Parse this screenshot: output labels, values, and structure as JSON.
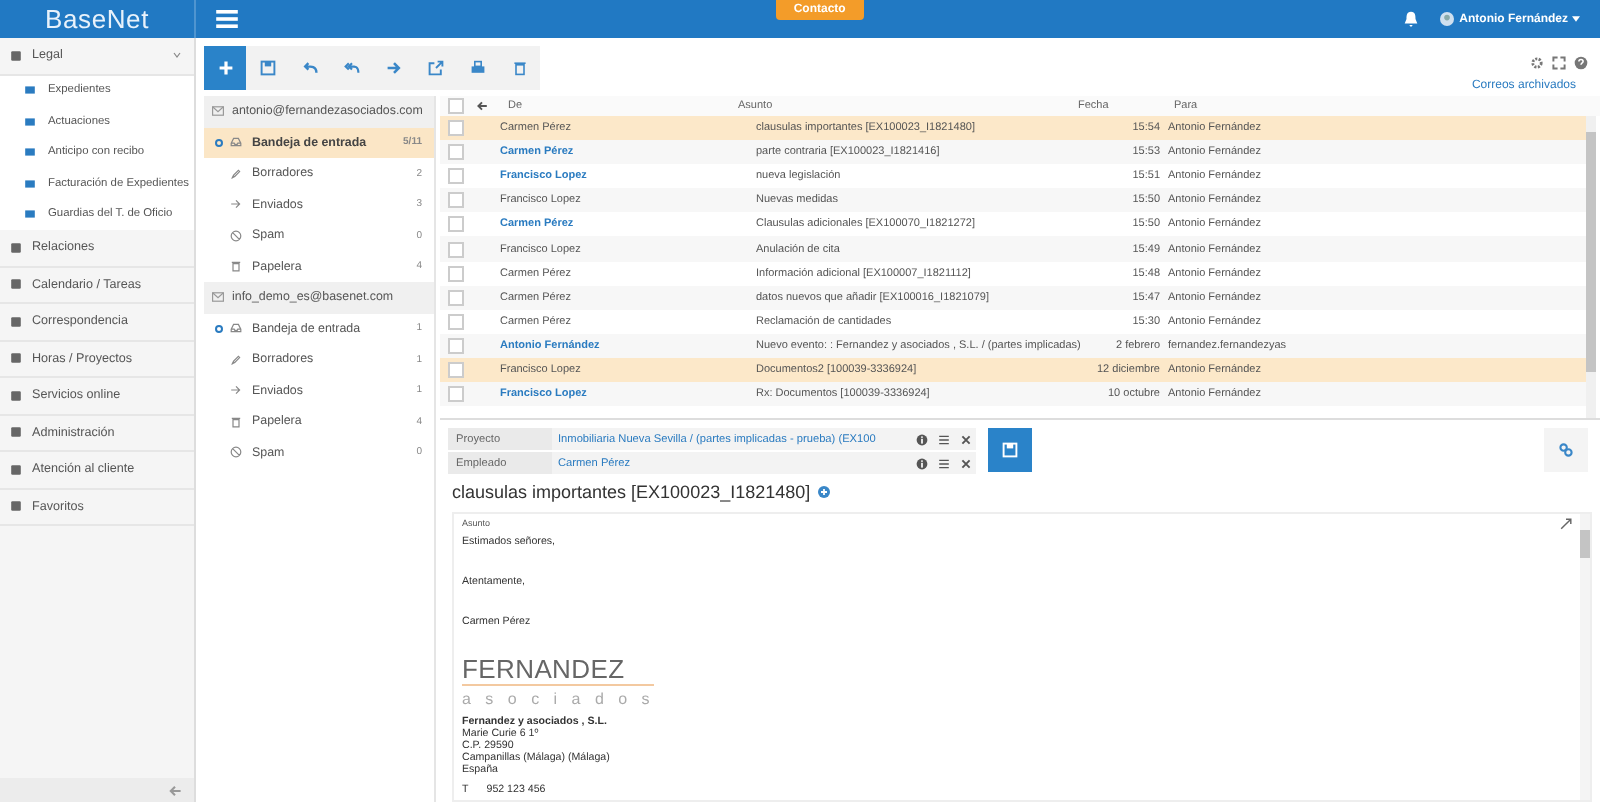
{
  "header": {
    "logo": "BaseNet",
    "contact_button": "Contacto",
    "user": "Antonio Fernández"
  },
  "sidebar": {
    "items": [
      {
        "label": "Legal",
        "expanded": true,
        "children": [
          {
            "label": "Expedientes"
          },
          {
            "label": "Actuaciones"
          },
          {
            "label": "Anticipo con recibo"
          },
          {
            "label": "Facturación de Expedientes"
          },
          {
            "label": "Guardias del T. de Oficio"
          }
        ]
      },
      {
        "label": "Relaciones"
      },
      {
        "label": "Calendario / Tareas"
      },
      {
        "label": "Correspondencia"
      },
      {
        "label": "Horas / Proyectos"
      },
      {
        "label": "Servicios online"
      },
      {
        "label": "Administración"
      },
      {
        "label": "Atención al cliente"
      },
      {
        "label": "Favoritos"
      }
    ]
  },
  "archived_link": "Correos archivados",
  "accounts": [
    {
      "address": "antonio@fernandezasociados.com",
      "folders": [
        {
          "kind": "inbox",
          "name": "Bandeja de entrada",
          "count": "5/11",
          "selected": true
        },
        {
          "kind": "drafts",
          "name": "Borradores",
          "count": "2",
          "selected": false
        },
        {
          "kind": "sent",
          "name": "Enviados",
          "count": "3",
          "selected": false
        },
        {
          "kind": "spam",
          "name": "Spam",
          "count": "0",
          "selected": false
        },
        {
          "kind": "trash",
          "name": "Papelera",
          "count": "4",
          "selected": false
        }
      ]
    },
    {
      "address": "info_demo_es@basenet.com",
      "folders": [
        {
          "kind": "inbox",
          "name": "Bandeja de entrada",
          "count": "1",
          "selected": false
        },
        {
          "kind": "drafts",
          "name": "Borradores",
          "count": "1",
          "selected": false
        },
        {
          "kind": "sent",
          "name": "Enviados",
          "count": "1",
          "selected": false
        },
        {
          "kind": "trash",
          "name": "Papelera",
          "count": "4",
          "selected": false
        },
        {
          "kind": "spam",
          "name": "Spam",
          "count": "0",
          "selected": false
        }
      ]
    }
  ],
  "mail_list": {
    "all_checked": false,
    "columns": [
      "De",
      "Asunto",
      "Fecha",
      "Para"
    ],
    "rows": [
      {
        "from": "Carmen Pérez",
        "subject": "clausulas importantes [EX100023_I1821480]",
        "date": "15:54",
        "to": "Antonio Fernández",
        "unread": false,
        "selected": true
      },
      {
        "from": "Carmen Pérez",
        "subject": "parte contraria [EX100023_I1821416]",
        "date": "15:53",
        "to": "Antonio Fernández",
        "unread": true,
        "selected": false
      },
      {
        "from": "Francisco Lopez",
        "subject": "nueva legislación",
        "date": "15:51",
        "to": "Antonio Fernández",
        "unread": true,
        "selected": false
      },
      {
        "from": "Francisco Lopez",
        "subject": "Nuevas medidas",
        "date": "15:50",
        "to": "Antonio Fernández",
        "unread": false,
        "selected": false
      },
      {
        "from": "Carmen Pérez",
        "subject": "Clausulas adicionales [EX100070_I1821272]",
        "date": "15:50",
        "to": "Antonio Fernández",
        "unread": true,
        "selected": false
      },
      {
        "from": "Francisco Lopez",
        "subject": "Anulación de cita",
        "date": "15:49",
        "to": "Antonio Fernández",
        "unread": false,
        "selected": false
      },
      {
        "from": "Carmen Pérez",
        "subject": "Información adicional [EX100007_I1821112]",
        "date": "15:48",
        "to": "Antonio Fernández",
        "unread": false,
        "selected": false
      },
      {
        "from": "Carmen Pérez",
        "subject": "datos nuevos que añadir [EX100016_I1821079]",
        "date": "15:47",
        "to": "Antonio Fernández",
        "unread": false,
        "selected": false
      },
      {
        "from": "Carmen Pérez",
        "subject": "Reclamación de cantidades",
        "date": "15:30",
        "to": "Antonio Fernández",
        "unread": false,
        "selected": false
      },
      {
        "from": "Antonio Fernández",
        "subject": "Nuevo evento: : Fernandez y asociados , S.L. / (partes implicadas)",
        "date": "2 febrero",
        "to": "fernandez.fernandezyas",
        "unread": true,
        "selected": false
      },
      {
        "from": "Francisco Lopez",
        "subject": "Documentos2 [100039-3336924]",
        "date": "12 diciembre",
        "to": "Antonio Fernández",
        "unread": false,
        "selected": true
      },
      {
        "from": "Francisco Lopez",
        "subject": "Rx: Documentos [100039-3336924]",
        "date": "10 octubre",
        "to": "Antonio Fernández",
        "unread": true,
        "selected": false
      }
    ]
  },
  "detail": {
    "fields": [
      {
        "label": "Proyecto",
        "value": "Inmobiliaria Nueva Sevilla / (partes implicadas - prueba)  (EX100"
      },
      {
        "label": "Empleado",
        "value": "Carmen Pérez"
      }
    ],
    "title": "clausulas importantes [EX100023_I1821480]",
    "body_label": "Asunto",
    "body": [
      "Estimados señores,",
      "Atentamente,",
      "Carmen Pérez"
    ],
    "logo_name": "FERNANDEZ",
    "logo_sub": "a s o c i a d o s",
    "company": "Fernandez y asociados , S.L.",
    "address": [
      "Marie Curie 6 1º",
      "C.P. 29590",
      "Campanillas (Málaga) (Málaga)",
      "España"
    ],
    "phone_label": "T",
    "phone": "952 123 456"
  }
}
